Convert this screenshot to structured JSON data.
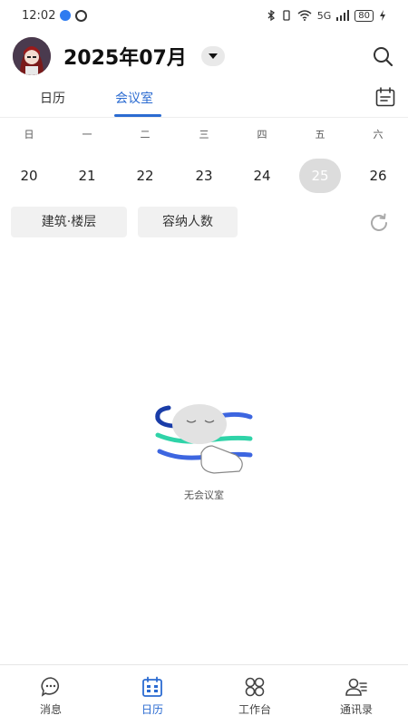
{
  "status_bar": {
    "time": "12:02",
    "network": "5G",
    "battery": "80"
  },
  "header": {
    "title": "2025年07月"
  },
  "tabs": [
    {
      "label": "日历"
    },
    {
      "label": "会议室"
    }
  ],
  "weekdays": [
    "日",
    "一",
    "二",
    "三",
    "四",
    "五",
    "六"
  ],
  "dates": [
    "20",
    "21",
    "22",
    "23",
    "24",
    "25",
    "26"
  ],
  "selected_date": "25",
  "filters": {
    "building": "建筑·楼层",
    "capacity": "容纳人数"
  },
  "empty_state": {
    "text": "无会议室"
  },
  "bottom_nav": [
    {
      "label": "消息",
      "icon": "chat-icon"
    },
    {
      "label": "日历",
      "icon": "calendar-icon"
    },
    {
      "label": "工作台",
      "icon": "apps-icon"
    },
    {
      "label": "通讯录",
      "icon": "contacts-icon"
    }
  ],
  "colors": {
    "accent": "#2b6bd1",
    "selected_date_bg": "#dcdcdc"
  }
}
